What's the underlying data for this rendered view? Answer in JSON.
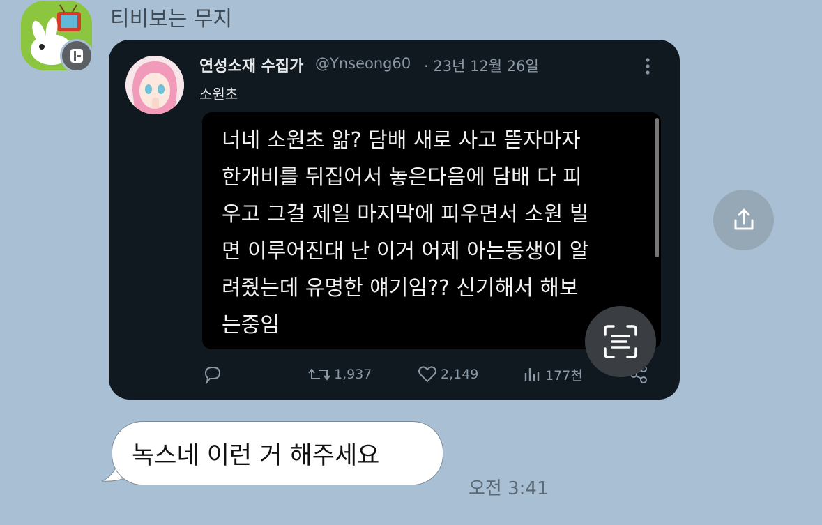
{
  "chat": {
    "sender_name": "티비보는 무지",
    "message_text": "녹스네 이런 거 해주세요",
    "time": "오전 3:41"
  },
  "tweet": {
    "author": "연성소재 수집가",
    "handle": "@Ynseong60",
    "date": "· 23년 12월 26일",
    "text": "소원초",
    "embedded_text": "너네 소원초 앎? 담배 새로 사고 뜯자마자\n한개비를 뒤집어서 놓은다음에 담배 다 피\n우고 그걸 제일 마지막에 피우면서 소원 빌\n면 이루어진대 난 이거 어제 아는동생이 알\n려줬는데 유명한 얘기임?? 신기해서 해보\n는중임",
    "retweets": "1,937",
    "likes": "2,149",
    "views": "177천"
  },
  "colors": {
    "background": "#a9bfd3",
    "card": "#101820",
    "accent_green": "#8cc63f"
  },
  "icons": [
    "muzi-profile-icon",
    "profile-badge-icon",
    "more-icon",
    "reply-icon",
    "retweet-icon",
    "like-icon",
    "views-icon",
    "share-icon",
    "text-scan-icon",
    "upload-share-icon"
  ]
}
